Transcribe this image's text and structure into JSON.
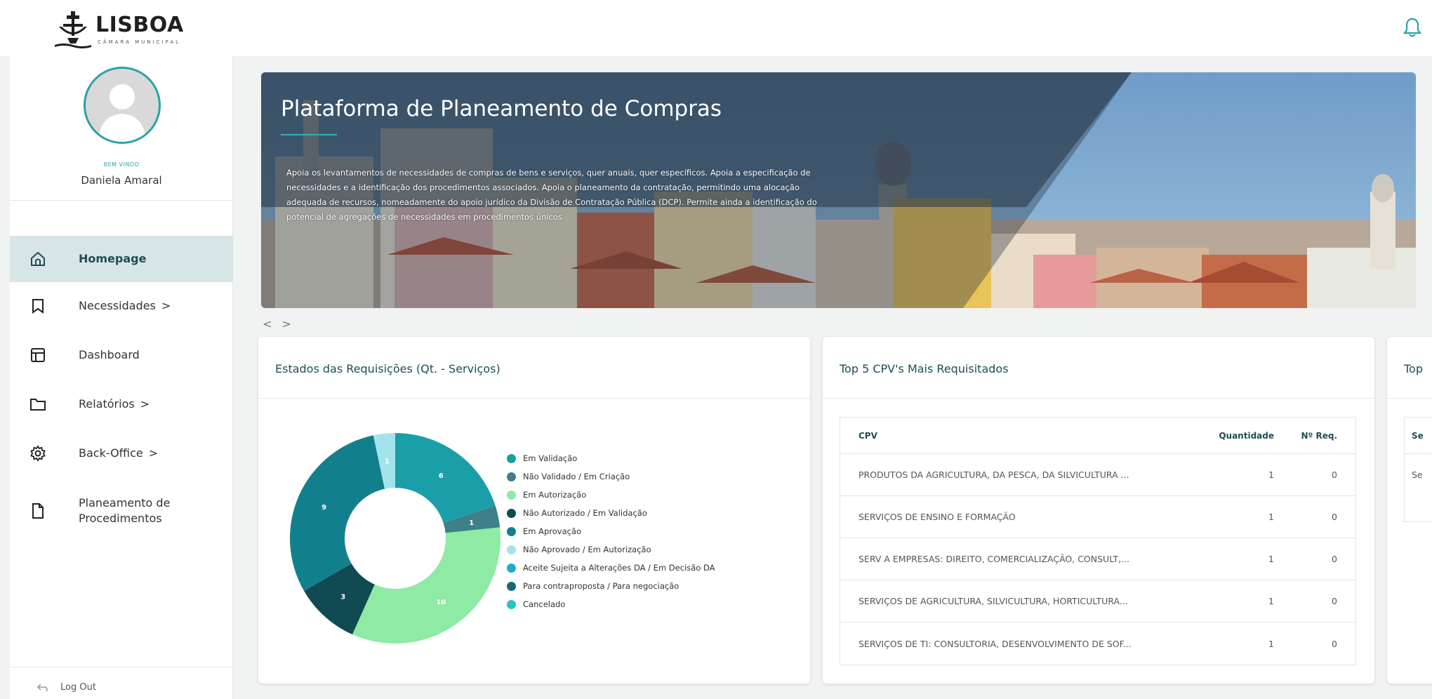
{
  "brand": {
    "name": "LISBOA",
    "subtitle": "CÂMARA MUNICIPAL"
  },
  "user": {
    "welcome": "BEM VINDO",
    "name": "Daniela Amaral"
  },
  "nav": {
    "items": [
      {
        "label": "Homepage",
        "icon": "home-icon",
        "active": true,
        "chevron": ""
      },
      {
        "label": "Necessidades",
        "icon": "bookmark-icon",
        "active": false,
        "chevron": ">"
      },
      {
        "label": "Dashboard",
        "icon": "layout-icon",
        "active": false,
        "chevron": ""
      },
      {
        "label": "Relatórios",
        "icon": "folder-icon",
        "active": false,
        "chevron": ">"
      },
      {
        "label": "Back-Office",
        "icon": "gear-icon",
        "active": false,
        "chevron": ">"
      },
      {
        "label": "Planeamento de Procedimentos",
        "icon": "document-icon",
        "active": false,
        "chevron": ""
      }
    ],
    "logout": "Log Out"
  },
  "banner": {
    "title": "Plataforma de Planeamento de Compras",
    "text": "Apoia os levantamentos de necessidades de compras de bens e serviços, quer anuais, quer específicos. Apoia a especificação de necessidades e a identificação dos procedimentos associados. Apoia o planeamento da contratação, permitindo uma alocação adequada de recursos, nomeadamente do apoio jurídico da Divisão de Contratação Pública (DCP). Permite ainda a identificação do potencial de agregações de necessidades em procedimentos únicos",
    "prev": "<",
    "next": ">"
  },
  "card_states": {
    "title": "Estados das Requisições (Qt. - Serviços)"
  },
  "chart_data": {
    "type": "pie",
    "title": "Estados das Requisições (Qt. - Serviços)",
    "series": [
      {
        "name": "Em Validação",
        "value": 6,
        "color": "#1a9fa8"
      },
      {
        "name": "Não Validado / Em Criação",
        "value": 1,
        "color": "#3d8088"
      },
      {
        "name": "Em Autorização",
        "value": 10,
        "color": "#8eeaa5"
      },
      {
        "name": "Não Autorizado / Em Validação",
        "value": 3,
        "color": "#114a52"
      },
      {
        "name": "Em Aprovação",
        "value": 9,
        "color": "#127f8d"
      },
      {
        "name": "Não Aprovado / Em Autorização",
        "value": 1,
        "color": "#a3e4ec"
      }
    ],
    "legend": [
      {
        "name": "Em Validação",
        "color": "#1a9fa8"
      },
      {
        "name": "Não Validado / Em Criação",
        "color": "#3d8088"
      },
      {
        "name": "Em Autorização",
        "color": "#8eeaa5"
      },
      {
        "name": "Não Autorizado / Em Validação",
        "color": "#114a52"
      },
      {
        "name": "Em Aprovação",
        "color": "#127f8d"
      },
      {
        "name": "Não Aprovado / Em Autorização",
        "color": "#a3e4ec"
      },
      {
        "name": "Aceite Sujeita a Alterações DA / Em Decisão DA",
        "color": "#1ab0c0"
      },
      {
        "name": "Para contraproposta / Para negociação",
        "color": "#166b72"
      },
      {
        "name": "Cancelado",
        "color": "#25c2c9"
      }
    ],
    "legend_position": "right"
  },
  "card_cpv": {
    "title": "Top 5 CPV's Mais Requisitados",
    "columns": {
      "cpv": "CPV",
      "qty": "Quantidade",
      "req": "Nº Req."
    },
    "rows": [
      {
        "cpv": "PRODUTOS DA AGRICULTURA, DA PESCA, DA SILVICULTURA ...",
        "qty": "1",
        "req": "0"
      },
      {
        "cpv": "SERVIÇOS DE ENSINO E FORMAÇÃO",
        "qty": "1",
        "req": "0"
      },
      {
        "cpv": "SERV A EMPRESAS: DIREITO, COMERCIALIZAÇÃO, CONSULT,...",
        "qty": "1",
        "req": "0"
      },
      {
        "cpv": "SERVIÇOS DE AGRICULTURA, SILVICULTURA, HORTICULTURA...",
        "qty": "1",
        "req": "0"
      },
      {
        "cpv": "SERVIÇOS DE TI: CONSULTORIA, DESENVOLVIMENTO DE SOF...",
        "qty": "1",
        "req": "0"
      }
    ]
  },
  "card_third": {
    "title": "Top",
    "header": "Se",
    "row": "Se"
  },
  "colors": {
    "accent": "#2aa3a3",
    "heading": "#1d4e55",
    "active_nav": "#d8e5e6"
  }
}
